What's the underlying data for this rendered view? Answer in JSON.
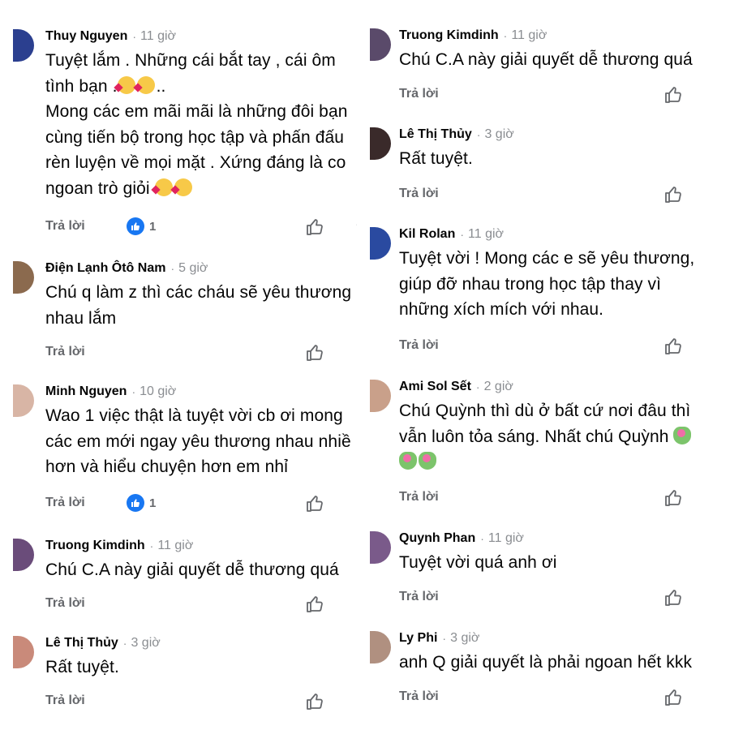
{
  "left": [
    {
      "name": "Thuy Nguyen",
      "time": "11 giờ",
      "lines": [
        "Tuyệt lắm . Những cái bắt tay , cái ôm",
        "tình bạn .",
        "Mong các em mãi mãi là những đôi bạn",
        "cùng tiến bộ trong học tập và phấn đấu",
        "rèn luyện về mọi mặt . Xứng đáng là co",
        "ngoan trò giỏi"
      ],
      "emoji_line2": "..",
      "reply": "Trả lời",
      "reactions": "1",
      "avatar_color": "#2b3f8f"
    },
    {
      "name": "Điện Lạnh Ôtô Nam",
      "time": "5 giờ",
      "lines": [
        "Chú q làm z thì các cháu sẽ yêu thương",
        "nhau lắm"
      ],
      "reply": "Trả lời",
      "avatar_color": "#8b6a4e"
    },
    {
      "name": "Minh Nguyen",
      "time": "10 giờ",
      "lines": [
        "Wao 1 việc thật là tuyệt vời cb ơi mong",
        "các em mới ngay yêu thương nhau nhiề",
        "hơn và hiểu chuyện hơn em nhỉ"
      ],
      "reply": "Trả lời",
      "reactions": "1",
      "avatar_color": "#d8b5a5"
    },
    {
      "name": "Truong Kimdinh",
      "time": "11 giờ",
      "lines": [
        "Chú C.A này giải quyết dễ thương quá"
      ],
      "reply": "Trả lời",
      "avatar_color": "#6a4c7a"
    },
    {
      "name": "Lê Thị Thủy",
      "time": "3 giờ",
      "lines": [
        "Rất tuyệt."
      ],
      "reply": "Trả lời",
      "avatar_color": "#c98a7a"
    }
  ],
  "right": [
    {
      "name": "Truong Kimdinh",
      "time": "11 giờ",
      "lines": [
        "Chú C.A này giải quyết dễ thương quá"
      ],
      "reply": "Trả lời",
      "avatar_color": "#5a4a6a"
    },
    {
      "name": "Lê Thị Thủy",
      "time": "3 giờ",
      "lines": [
        "Rất tuyệt."
      ],
      "reply": "Trả lời",
      "avatar_color": "#3a2a2a"
    },
    {
      "name": "Kil Rolan",
      "time": "11 giờ",
      "lines": [
        "Tuyệt vời ! Mong các e sẽ yêu thương,",
        "giúp đỡ nhau trong học tập thay vì",
        "những xích mích với nhau."
      ],
      "reply": "Trả lời",
      "avatar_color": "#2a4aa0"
    },
    {
      "name": "Ami Sol Sết",
      "time": "2 giờ",
      "lines": [
        "Chú Quỳnh thì dù ở bất cứ nơi đâu thì",
        "vẫn luôn tỏa sáng. Nhất chú Quỳnh"
      ],
      "reply": "Trả lời",
      "avatar_color": "#c9a08a"
    },
    {
      "name": "Quynh Phan",
      "time": "11 giờ",
      "lines": [
        "Tuyệt vời quá anh ơi"
      ],
      "reply": "Trả lời",
      "avatar_color": "#7a5a8a"
    },
    {
      "name": "Ly Phi",
      "time": "3 giờ",
      "lines": [
        "anh Q giải quyết là phải ngoan hết kkk"
      ],
      "reply": "Trả lời",
      "avatar_color": "#b09080"
    }
  ]
}
